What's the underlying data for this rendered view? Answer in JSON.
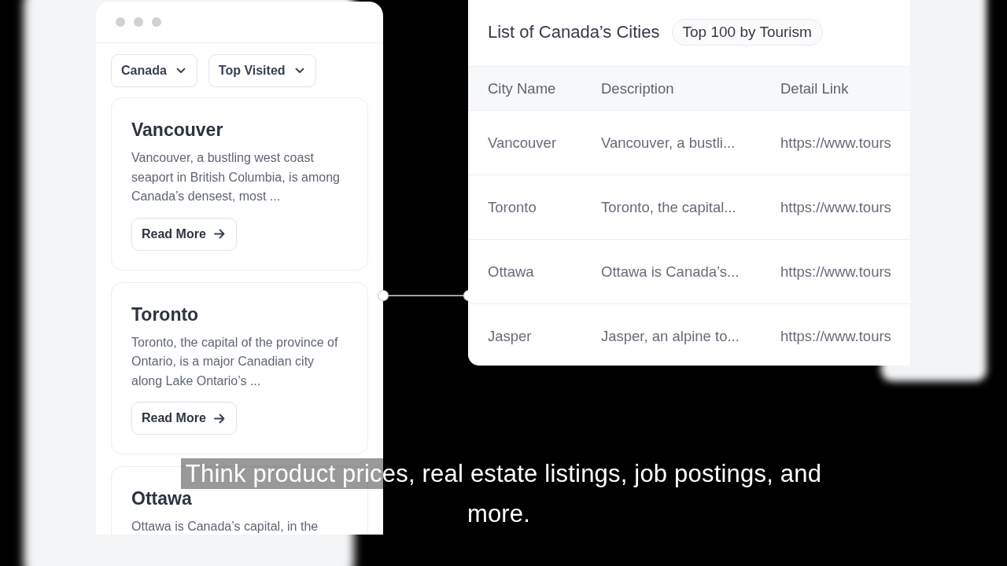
{
  "app_window": {
    "filters": [
      {
        "label": "Canada",
        "kind": "dropdown"
      },
      {
        "label": "Top Visited",
        "kind": "dropdown"
      }
    ],
    "cards": [
      {
        "title": "Vancouver",
        "description": "Vancouver, a bustling west coast seaport in British Columbia, is among Canada’s densest, most ...",
        "button": "Read More"
      },
      {
        "title": "Toronto",
        "description": "Toronto, the capital of the province of Ontario, is a major Canadian city along Lake Ontario’s ...",
        "button": "Read More"
      },
      {
        "title": "Ottawa",
        "description": "Ottawa is Canada’s capital, in the"
      }
    ]
  },
  "table": {
    "title": "List of Canada’s Cities",
    "badge": "Top 100 by Tourism",
    "columns": [
      "City Name",
      "Description",
      "Detail Link"
    ],
    "rows": [
      [
        "Vancouver",
        "Vancouver, a bustli...",
        "https://www.tours"
      ],
      [
        "Toronto",
        "Toronto, the capital...",
        "https://www.tours"
      ],
      [
        "Ottawa",
        "Ottawa is Canada’s...",
        "https://www.tours"
      ],
      [
        "Jasper",
        "Jasper, an alpine to...",
        "https://www.tours"
      ]
    ]
  },
  "caption": "Think product prices, real estate listings, job postings, and more."
}
